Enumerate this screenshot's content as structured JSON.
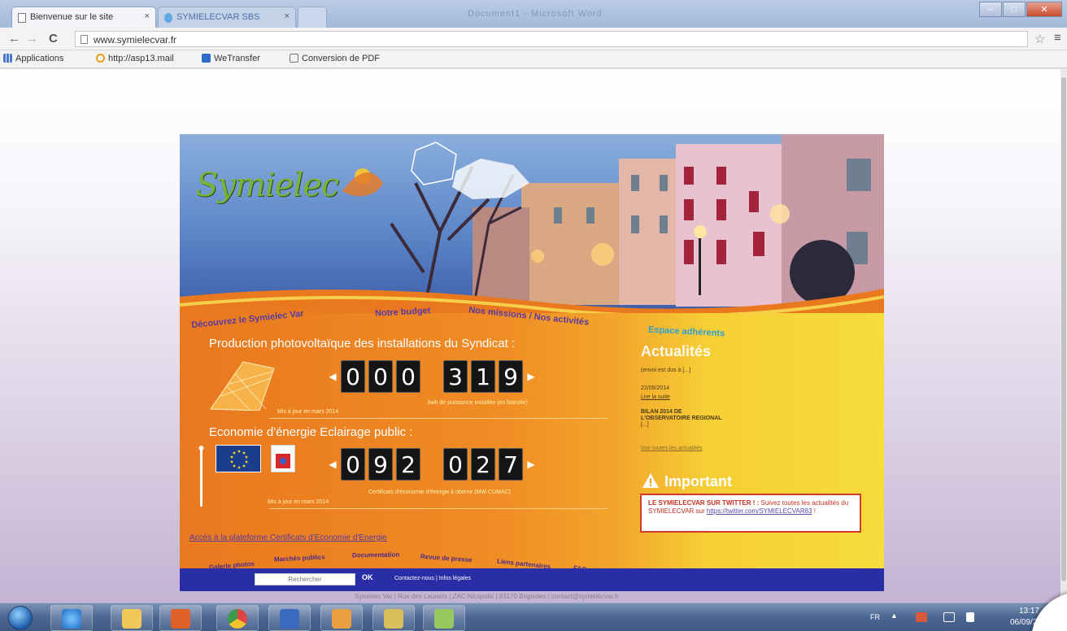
{
  "browser": {
    "tabs": [
      {
        "title": "Bienvenue sur le site",
        "close": "×"
      },
      {
        "title": "SYMIELECVAR SBS",
        "close": "×"
      }
    ],
    "window_title_ghost": "Document1 - Microsoft Word",
    "url": "www.symielecvar.fr",
    "bookmarks": {
      "apps": "Applications",
      "asp": "http://asp13.mail",
      "wetransfer": "WeTransfer",
      "conversion": "Conversion de PDF"
    }
  },
  "site": {
    "logo": "Symielec",
    "nav": {
      "decouvrez": "Découvrez le Symielec Var",
      "budget": "Notre budget",
      "missions": "Nos missions / Nos activités",
      "espace": "Espace adhérents"
    },
    "pv": {
      "title": "Production photovoltaïque des installations du Syndicat :",
      "digits": [
        "0",
        "0",
        "0",
        "3",
        "1",
        "9"
      ],
      "caption": "kwh de puissance installée (en batroite)",
      "date": "Mis à jour en mars 2014"
    },
    "eco": {
      "title": "Economie d'énergie Eclairage public :",
      "digits": [
        "0",
        "9",
        "2",
        "0",
        "2",
        "7"
      ],
      "caption": "Certificats d'économie d'énergie à obtenir (MW CUMAC)",
      "date": "Mis à jour en mars 2014"
    },
    "actualites": {
      "title": "Actualités",
      "item1": "(envoi est dus à [...]",
      "item2_date": "22/05/2014",
      "item2_link": "Lire la suite",
      "item3_line1": "BILAN 2014 DE",
      "item3_line2": "L'OBSERVATOIRE REGIONAL",
      "item3_line3": "[...]",
      "all_link": "Voir toutes les actualités"
    },
    "important": {
      "title": "Important",
      "strong": "LE SYMIELECVAR SUR TWITTER ! :",
      "text": " Suivez toutes les actualités du SYMIELECVAR sur ",
      "link": "https://twitter.com/SYMIELECVAR83",
      "end": " !"
    },
    "acces_link": "Accès à la plateforme Certificats d'Economie d'Energie",
    "bottom_links": [
      "Galerie photos",
      "Marchés publics",
      "Documentation",
      "Revue de presse",
      "Liens partenaires",
      "FAQ"
    ],
    "search": {
      "placeholder": "Rechercher",
      "ok": "OK"
    },
    "footer_links": "Contactez-nous | Infos légales"
  },
  "below_footer": "Symielec Var | Rue des Lauriers | ZAC Nicopolis | 83170 Brignoles | contact@symielecvar.fr",
  "taskbar": {
    "lang": "FR",
    "time": "13:17",
    "date": "06/09/20"
  }
}
